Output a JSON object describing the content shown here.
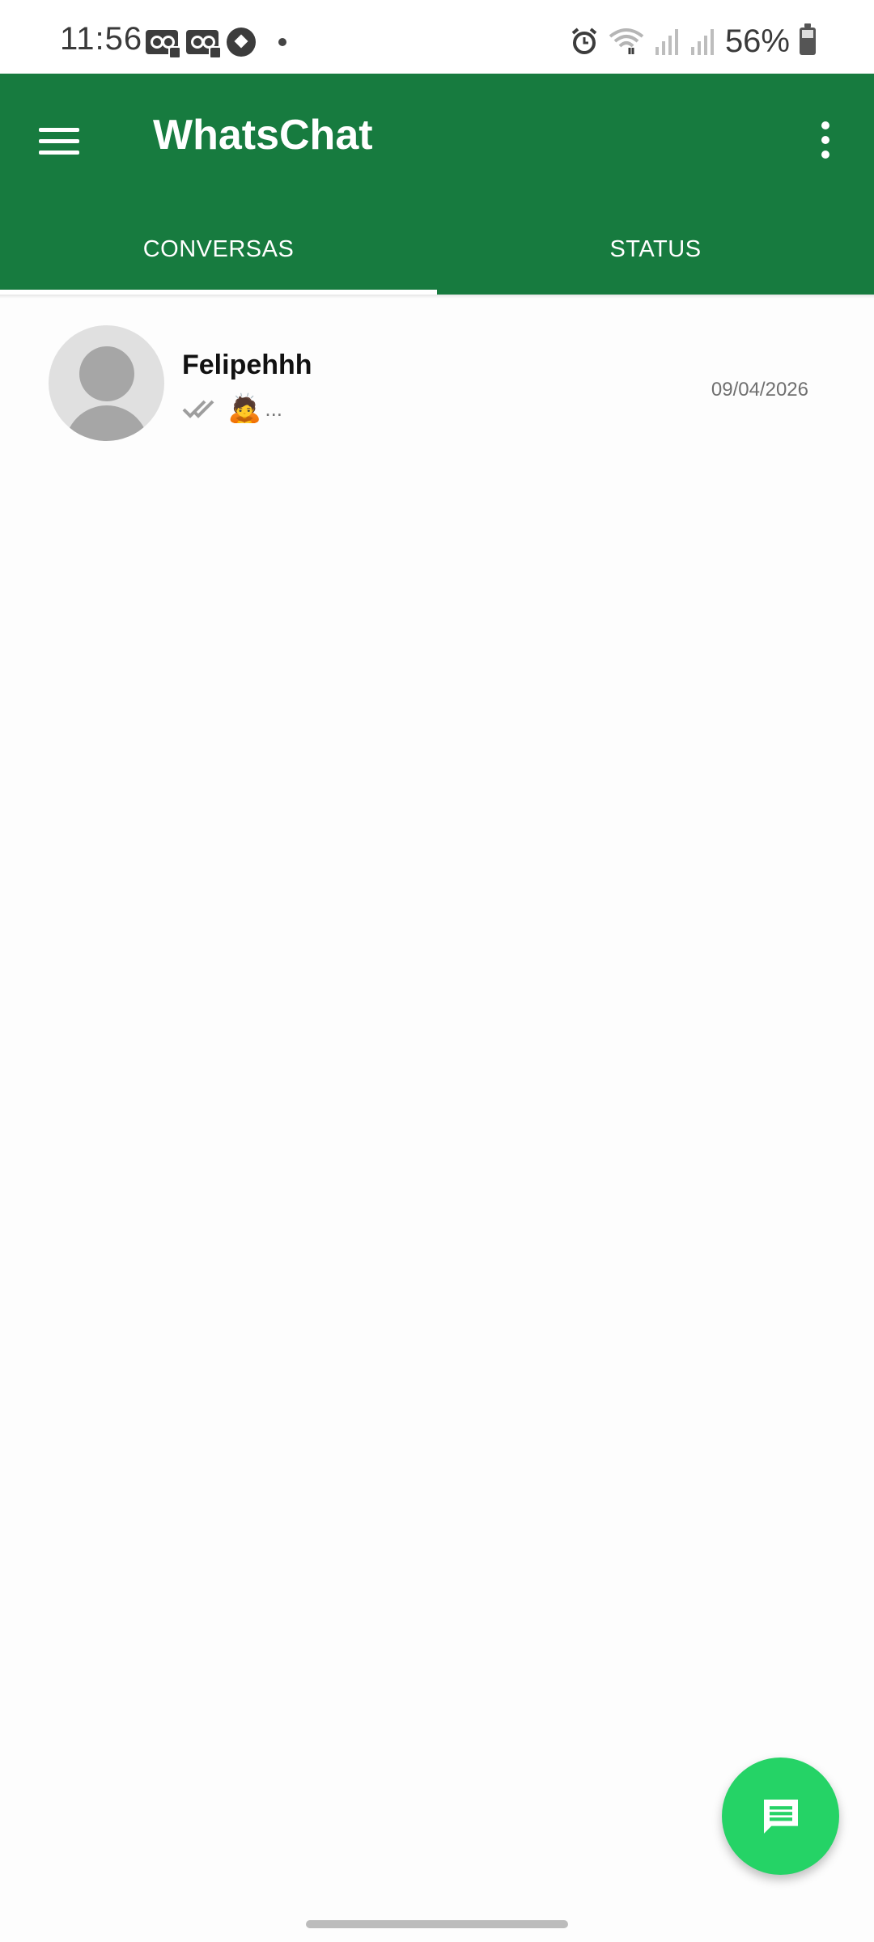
{
  "status_bar": {
    "time": "11:56",
    "battery": "56%",
    "left_icons": [
      "voicemail-icon",
      "voicemail-icon",
      "soccer-ball-icon",
      "dot-icon"
    ],
    "right_icons": [
      "alarm-icon",
      "wifi-icon",
      "signal-icon",
      "signal-icon",
      "battery-icon"
    ]
  },
  "app_bar": {
    "title": "WhatsChat",
    "background": "#177b3f",
    "menu_icon": "hamburger-menu-icon",
    "more_icon": "more-vert-icon"
  },
  "tabs": [
    {
      "label": "CONVERSAS",
      "active": true
    },
    {
      "label": "STATUS",
      "active": false
    }
  ],
  "chats": [
    {
      "name": "Felipehhh",
      "preview_emoji": "🙇",
      "preview_text": "...",
      "date": "09/04/2026",
      "status_icon": "double-check-icon",
      "avatar": "default-avatar-icon"
    }
  ],
  "fab": {
    "icon": "chat-message-icon",
    "color": "#25d366"
  }
}
